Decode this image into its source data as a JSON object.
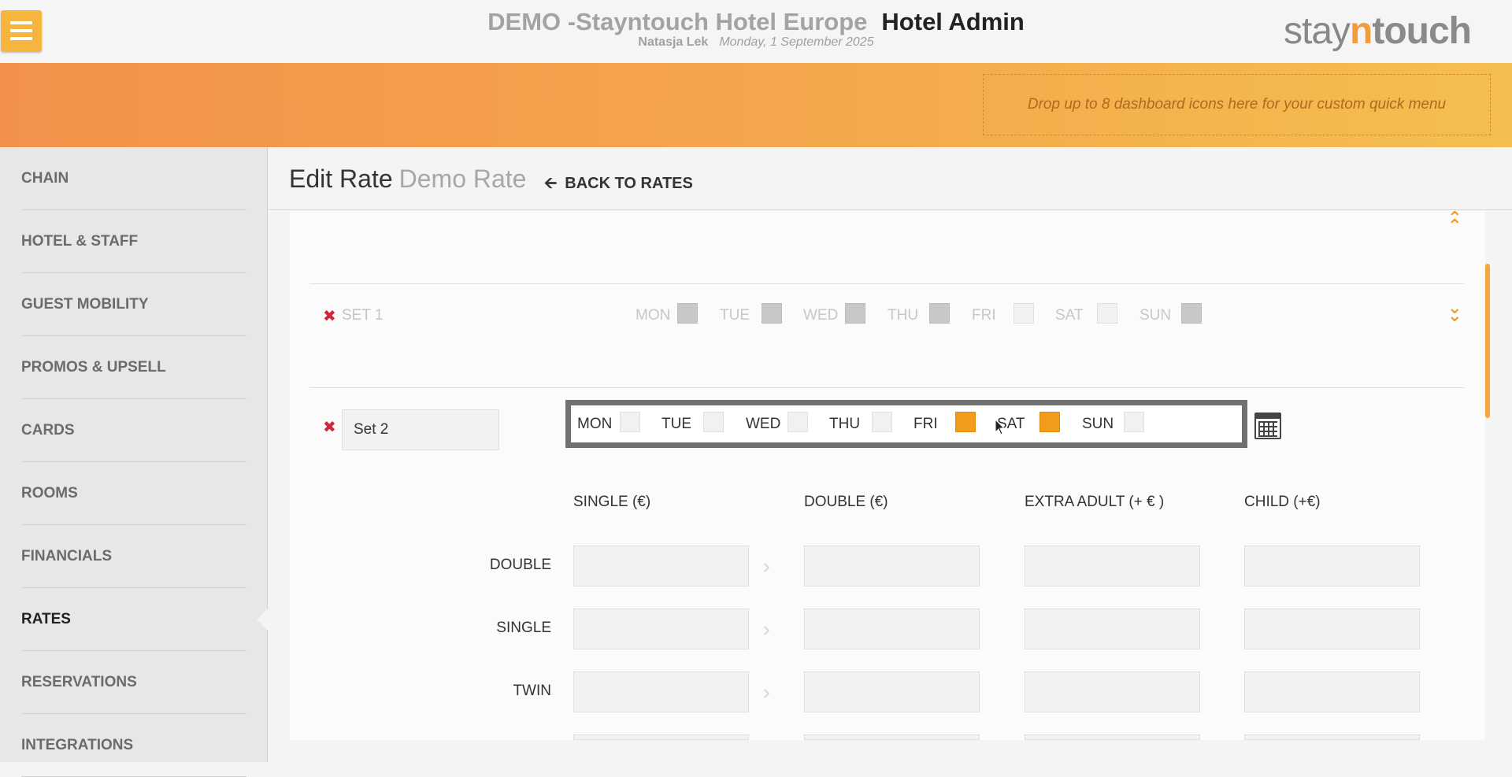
{
  "header": {
    "hotel_name": "DEMO -Stayntouch Hotel Europe",
    "app_name": "Hotel Admin",
    "user": "Natasja Lek",
    "date": "Monday, 1 September 2025",
    "logo_pre": "stay",
    "logo_n": "n",
    "logo_post": "touch"
  },
  "quick_menu": {
    "placeholder": "Drop up to 8 dashboard icons here for your custom quick menu"
  },
  "sidebar": {
    "items": [
      {
        "label": "CHAIN"
      },
      {
        "label": "HOTEL & STAFF"
      },
      {
        "label": "GUEST MOBILITY"
      },
      {
        "label": "PROMOS & UPSELL"
      },
      {
        "label": "CARDS"
      },
      {
        "label": "ROOMS"
      },
      {
        "label": "FINANCIALS"
      },
      {
        "label": "RATES"
      },
      {
        "label": "RESERVATIONS"
      },
      {
        "label": "INTEGRATIONS"
      }
    ],
    "active": "RATES"
  },
  "page": {
    "title": "Edit Rate",
    "rate_name": "Demo Rate",
    "back_label": "BACK TO RATES"
  },
  "sets": [
    {
      "name": "SET 1",
      "days": [
        {
          "label": "MON",
          "checked": true
        },
        {
          "label": "TUE",
          "checked": true
        },
        {
          "label": "WED",
          "checked": true
        },
        {
          "label": "THU",
          "checked": true
        },
        {
          "label": "FRI",
          "checked": false
        },
        {
          "label": "SAT",
          "checked": false
        },
        {
          "label": "SUN",
          "checked": true
        }
      ]
    },
    {
      "name": "Set 2",
      "days": [
        {
          "label": "MON",
          "checked": false
        },
        {
          "label": "TUE",
          "checked": false
        },
        {
          "label": "WED",
          "checked": false
        },
        {
          "label": "THU",
          "checked": false
        },
        {
          "label": "FRI",
          "checked": true
        },
        {
          "label": "SAT",
          "checked": true
        },
        {
          "label": "SUN",
          "checked": false
        }
      ]
    }
  ],
  "table": {
    "columns": [
      "SINGLE (€)",
      "DOUBLE (€)",
      "EXTRA ADULT (+ € )",
      "CHILD (+€)"
    ],
    "rows": [
      "DOUBLE",
      "SINGLE",
      "TWIN"
    ]
  },
  "colors": {
    "accent": "#f39c1c",
    "remove": "#d0263b"
  }
}
